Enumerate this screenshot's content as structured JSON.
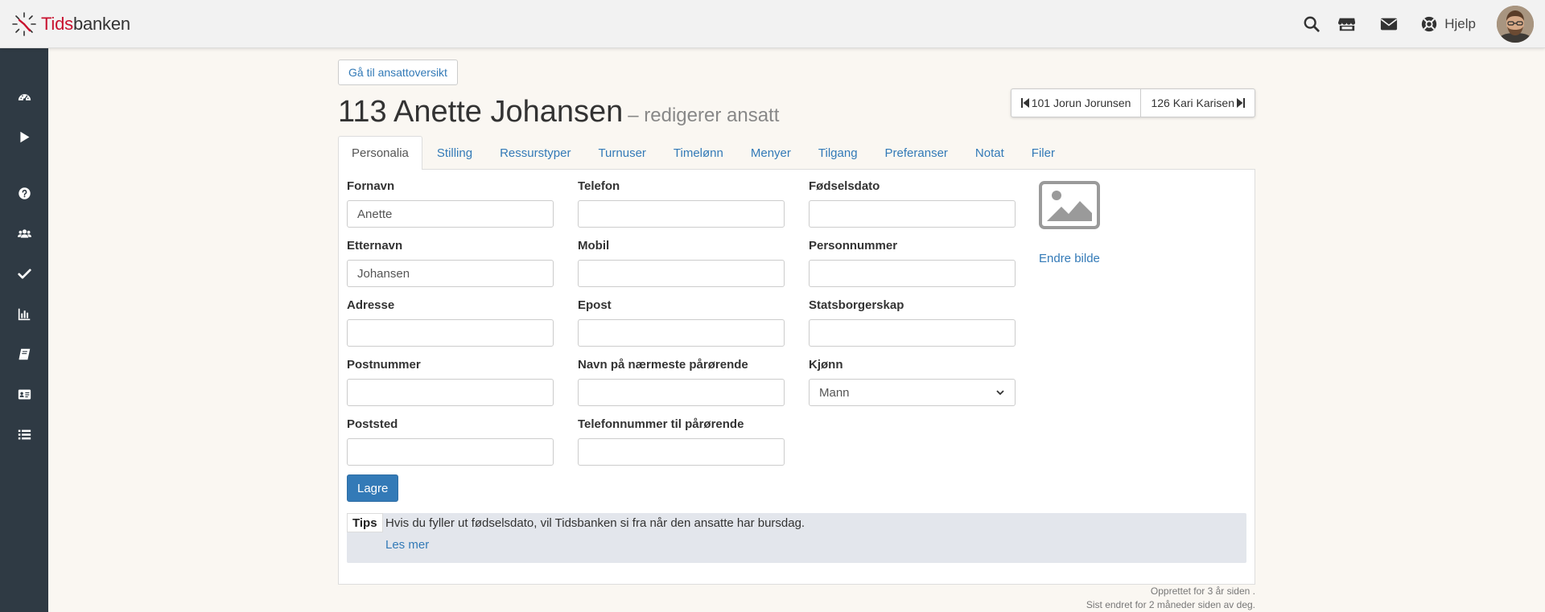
{
  "brand": {
    "name_red": "Tids",
    "name_rest": "banken",
    "red": "#c8102e"
  },
  "topbar": {
    "icons": [
      "search-icon",
      "store-icon",
      "envelope-icon",
      "lifebuoy-icon"
    ],
    "help_label": "Hjelp"
  },
  "sidebar": {
    "bg": "#2f3a44",
    "items": [
      "dashboard-icon",
      "play-icon",
      "question-icon",
      "users-icon",
      "check-icon",
      "bar-chart-icon",
      "book-icon",
      "id-card-icon",
      "list-icon"
    ]
  },
  "header": {
    "overview_button": "Gå til ansattoversikt",
    "title": "113 Anette Johansen",
    "subtitle": "– redigerer ansatt",
    "prev_employee": "101 Jorun Jorunsen",
    "next_employee": "126 Kari Karisen"
  },
  "tabs": [
    "Personalia",
    "Stilling",
    "Ressurstyper",
    "Turnuser",
    "Timelønn",
    "Menyer",
    "Tilgang",
    "Preferanser",
    "Notat",
    "Filer"
  ],
  "form": {
    "fornavn": {
      "label": "Fornavn",
      "value": "Anette"
    },
    "etternavn": {
      "label": "Etternavn",
      "value": "Johansen"
    },
    "adresse": {
      "label": "Adresse",
      "value": ""
    },
    "postnummer": {
      "label": "Postnummer",
      "value": ""
    },
    "poststed": {
      "label": "Poststed",
      "value": ""
    },
    "telefon": {
      "label": "Telefon",
      "value": ""
    },
    "mobil": {
      "label": "Mobil",
      "value": ""
    },
    "epost": {
      "label": "Epost",
      "value": ""
    },
    "parorende_navn": {
      "label": "Navn på nærmeste pårørende",
      "value": ""
    },
    "parorende_tlf": {
      "label": "Telefonnummer til pårørende",
      "value": ""
    },
    "fodselsdato": {
      "label": "Fødselsdato",
      "value": ""
    },
    "personnummer": {
      "label": "Personnummer",
      "value": ""
    },
    "statsborgerskap": {
      "label": "Statsborgerskap",
      "value": ""
    },
    "kjonn": {
      "label": "Kjønn",
      "value": "Mann"
    }
  },
  "photo": {
    "icon": "image-placeholder-icon",
    "change_label": "Endre bilde"
  },
  "save_label": "Lagre",
  "tips": {
    "label": "Tips",
    "text": "Hvis du fyller ut fødselsdato, vil Tidsbanken si fra når den ansatte har bursdag.",
    "link": "Les mer"
  },
  "meta": {
    "created": "Opprettet for 3 år siden .",
    "modified": "Sist endret for 2 måneder siden av deg."
  },
  "colors": {
    "link": "#337ab7",
    "primary": "#337ab7",
    "page_bg": "#faf7f2"
  }
}
